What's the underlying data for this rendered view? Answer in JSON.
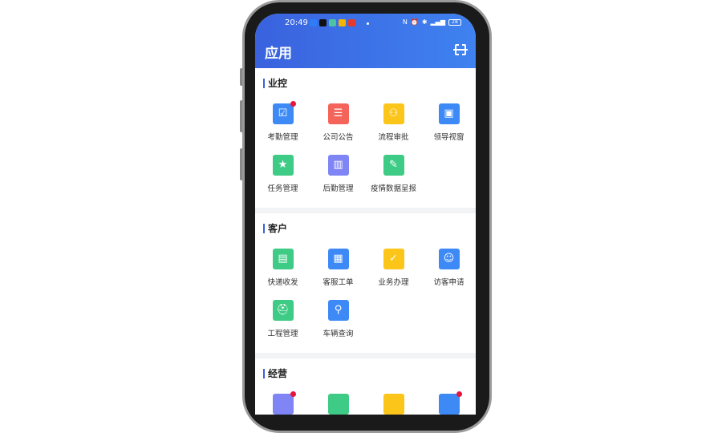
{
  "status": {
    "time": "20:49",
    "battery": "28",
    "app_colors": [
      "#2e7cf6",
      "#111111",
      "#4fc3a1",
      "#f5b400",
      "#e53b2c"
    ]
  },
  "header": {
    "title": "应用",
    "scan_icon": "scan-icon"
  },
  "sections": [
    {
      "title": "业控",
      "items": [
        {
          "label": "考勤管理",
          "color": "#3d8af7",
          "glyph": "☑",
          "badge": true
        },
        {
          "label": "公司公告",
          "color": "#f4645a",
          "glyph": "☰",
          "badge": false
        },
        {
          "label": "流程审批",
          "color": "#fbc51a",
          "glyph": "⚇",
          "badge": false
        },
        {
          "label": "领导视窗",
          "color": "#3d8af7",
          "glyph": "▣",
          "badge": false
        },
        {
          "label": "任务管理",
          "color": "#3ecb85",
          "glyph": "★",
          "badge": false
        },
        {
          "label": "后勤管理",
          "color": "#7f85f5",
          "glyph": "▥",
          "badge": false
        },
        {
          "label": "疫情数据呈报",
          "color": "#3ecb85",
          "glyph": "✎",
          "badge": false
        }
      ]
    },
    {
      "title": "客户",
      "items": [
        {
          "label": "快递收发",
          "color": "#3ecb85",
          "glyph": "▤",
          "badge": false
        },
        {
          "label": "客服工单",
          "color": "#3d8af7",
          "glyph": "▦",
          "badge": false
        },
        {
          "label": "业务办理",
          "color": "#fbc51a",
          "glyph": "✓",
          "badge": false
        },
        {
          "label": "访客申请",
          "color": "#3d8af7",
          "glyph": "☺",
          "badge": false
        },
        {
          "label": "工程管理",
          "color": "#3ecb85",
          "glyph": "⛑",
          "badge": false
        },
        {
          "label": "车辆查询",
          "color": "#3d8af7",
          "glyph": "⚲",
          "badge": false
        }
      ]
    },
    {
      "title": "经营",
      "items": [
        {
          "label": "",
          "color": "#7f85f5",
          "glyph": "",
          "badge": true
        },
        {
          "label": "",
          "color": "#3ecb85",
          "glyph": "",
          "badge": false
        },
        {
          "label": "",
          "color": "#fbc51a",
          "glyph": "",
          "badge": false
        },
        {
          "label": "",
          "color": "#3d8af7",
          "glyph": "",
          "badge": true
        }
      ]
    }
  ]
}
